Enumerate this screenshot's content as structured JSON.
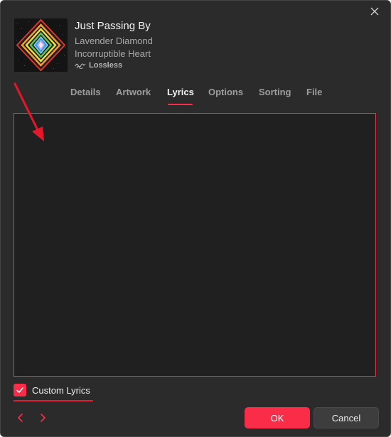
{
  "song": {
    "title": "Just Passing By",
    "artist": "Lavender Diamond",
    "album": "Incorruptible Heart",
    "quality": "Lossless"
  },
  "tabs": [
    {
      "label": "Details",
      "active": false
    },
    {
      "label": "Artwork",
      "active": false
    },
    {
      "label": "Lyrics",
      "active": true
    },
    {
      "label": "Options",
      "active": false
    },
    {
      "label": "Sorting",
      "active": false
    },
    {
      "label": "File",
      "active": false
    }
  ],
  "lyrics": {
    "value": ""
  },
  "custom_lyrics": {
    "label": "Custom Lyrics",
    "checked": true
  },
  "buttons": {
    "ok_label": "OK",
    "cancel_label": "Cancel"
  },
  "icons": {
    "close": "close-icon",
    "lossless": "lossless-wave-icon",
    "check": "checkmark-icon",
    "prev": "chevron-left-icon",
    "next": "chevron-right-icon"
  },
  "colors": {
    "accent": "#fa2d48",
    "background": "#2b2b2b",
    "lyrics_border": "#e03a50",
    "annotation_arrow": "#e8162a"
  }
}
